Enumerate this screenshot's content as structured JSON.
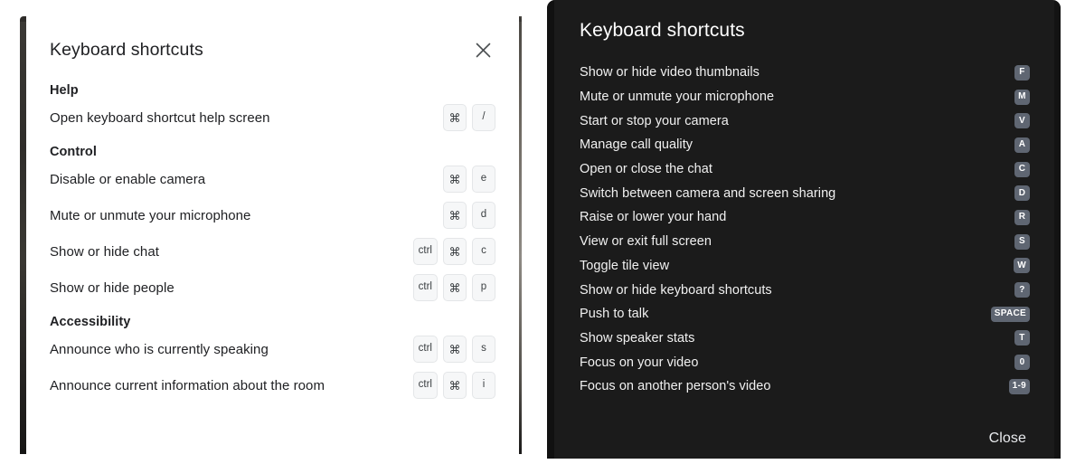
{
  "light_dialog": {
    "title": "Keyboard shortcuts",
    "close_icon": "close-icon",
    "sections": [
      {
        "heading": "Help",
        "rows": [
          {
            "label": "Open keyboard shortcut help screen",
            "keys": [
              "⌘",
              "/"
            ]
          }
        ]
      },
      {
        "heading": "Control",
        "rows": [
          {
            "label": "Disable or enable camera",
            "keys": [
              "⌘",
              "e"
            ]
          },
          {
            "label": "Mute or unmute your microphone",
            "keys": [
              "⌘",
              "d"
            ]
          },
          {
            "label": "Show or hide chat",
            "keys": [
              "ctrl",
              "⌘",
              "c"
            ]
          },
          {
            "label": "Show or hide people",
            "keys": [
              "ctrl",
              "⌘",
              "p"
            ]
          }
        ]
      },
      {
        "heading": "Accessibility",
        "rows": [
          {
            "label": "Announce who is currently speaking",
            "keys": [
              "ctrl",
              "⌘",
              "s"
            ]
          },
          {
            "label": "Announce current information about the room",
            "keys": [
              "ctrl",
              "⌘",
              "i"
            ]
          }
        ]
      }
    ]
  },
  "dark_dialog": {
    "title": "Keyboard shortcuts",
    "close_label": "Close",
    "rows": [
      {
        "label": "Show or hide video thumbnails",
        "key": "F"
      },
      {
        "label": "Mute or unmute your microphone",
        "key": "M"
      },
      {
        "label": "Start or stop your camera",
        "key": "V"
      },
      {
        "label": "Manage call quality",
        "key": "A"
      },
      {
        "label": "Open or close the chat",
        "key": "C"
      },
      {
        "label": "Switch between camera and screen sharing",
        "key": "D"
      },
      {
        "label": "Raise or lower your hand",
        "key": "R"
      },
      {
        "label": "View or exit full screen",
        "key": "S"
      },
      {
        "label": "Toggle tile view",
        "key": "W"
      },
      {
        "label": "Show or hide keyboard shortcuts",
        "key": "?"
      },
      {
        "label": "Push to talk",
        "key": "SPACE"
      },
      {
        "label": "Show speaker stats",
        "key": "T"
      },
      {
        "label": "Focus on your video",
        "key": "0"
      },
      {
        "label": "Focus on another person's video",
        "key": "1-9"
      }
    ]
  },
  "colors": {
    "light_dialog_bg": "#ffffff",
    "light_text": "#202124",
    "light_key_bg": "#f6f7f8",
    "light_key_border": "#e4e6e8",
    "dark_dialog_bg": "#1b1b1b",
    "dark_text": "#f1f1f1",
    "dark_key_bg": "#5f6672",
    "dark_key_text": "#ffffff"
  }
}
